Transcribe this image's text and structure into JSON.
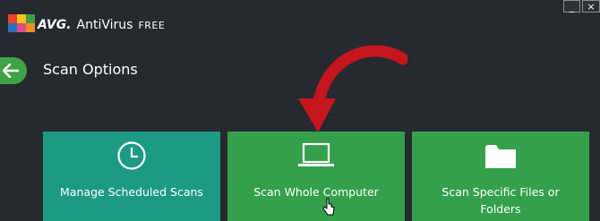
{
  "window": {
    "minimize_glyph": "_",
    "close_glyph": "×"
  },
  "header": {
    "brand": "AVG.",
    "product": "AntiVirus",
    "edition": "FREE"
  },
  "page": {
    "title": "Scan Options"
  },
  "tiles": [
    {
      "label": "Manage Scheduled Scans",
      "icon": "clock-icon",
      "color": "#1d9a83"
    },
    {
      "label": "Scan Whole Computer",
      "icon": "laptop-icon",
      "color": "#34a04b"
    },
    {
      "label": "Scan Specific Files or Folders",
      "icon": "folder-icon",
      "color": "#34a04b"
    }
  ],
  "annotation": {
    "arrow_color": "#c4161c"
  }
}
